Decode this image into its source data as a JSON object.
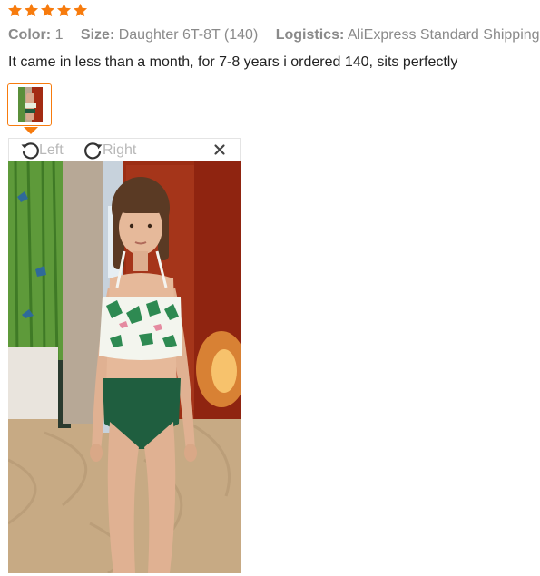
{
  "colors": {
    "accent": "#f77b0d",
    "star": "#f77b0d"
  },
  "rating": {
    "stars": 5,
    "icon": "star-icon"
  },
  "attributes": [
    {
      "label": "Color:",
      "value": "1"
    },
    {
      "label": "Size:",
      "value": "Daughter 6T-8T (140)"
    },
    {
      "label": "Logistics:",
      "value": "AliExpress Standard Shipping"
    }
  ],
  "review_text": "It came in less than a month, for 7-8 years i ordered 140, sits perfectly",
  "viewer": {
    "rotate_left_label": "Left",
    "rotate_right_label": "Right",
    "rotate_left_icon": "rotate-left-icon",
    "rotate_right_icon": "rotate-right-icon",
    "close_icon": "close-icon"
  }
}
